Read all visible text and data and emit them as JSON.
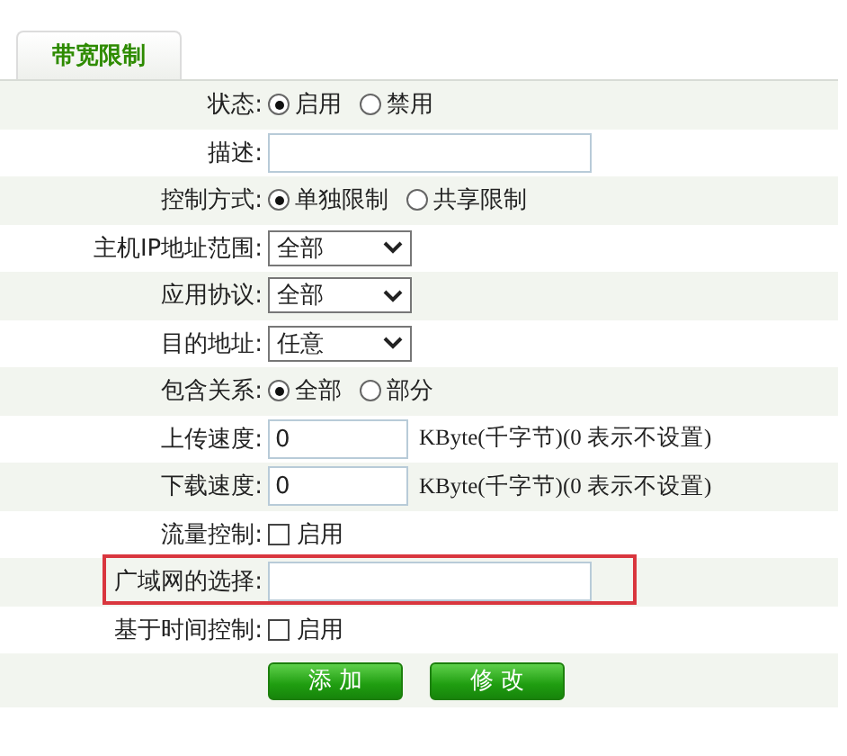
{
  "tabs": [
    {
      "label": "带宽限制",
      "selected": true
    }
  ],
  "rows": [
    {
      "label": "状态:",
      "kind": "radio",
      "options": [
        {
          "label": "启用",
          "selected": true
        },
        {
          "label": "禁用",
          "selected": false
        }
      ]
    },
    {
      "label": "描述:",
      "kind": "input"
    },
    {
      "label": "控制方式:",
      "kind": "radio",
      "options": [
        {
          "label": "单独限制",
          "selected": true
        },
        {
          "label": "共享限制",
          "selected": false
        }
      ]
    },
    {
      "label": "主机IP地址范围:",
      "kind": "select",
      "value": "全部"
    },
    {
      "label": "应用协议:",
      "kind": "select",
      "value": "全部"
    },
    {
      "label": "目的地址:",
      "kind": "select",
      "value": "任意"
    },
    {
      "label": "包含关系:",
      "kind": "radio",
      "options": [
        {
          "label": "全部",
          "selected": true
        },
        {
          "label": "部分",
          "selected": false
        }
      ]
    },
    {
      "label": "上传速度:",
      "kind": "input",
      "value": "0",
      "unit": "KByte(千字节)(0 表示不设置)"
    },
    {
      "label": "下载速度:",
      "kind": "input",
      "value": "0",
      "unit": "KByte(千字节)(0 表示不设置)"
    },
    {
      "label": "流量控制:",
      "kind": "checkbox",
      "checked": false,
      "text": "启用"
    },
    {
      "label": "广域网的选择:",
      "kind": "input",
      "highlighted": true
    },
    {
      "label": "基于时间控制:",
      "kind": "checkbox",
      "checked": false,
      "text": "启用"
    }
  ],
  "buttons": [
    "添 加",
    "修 改"
  ]
}
